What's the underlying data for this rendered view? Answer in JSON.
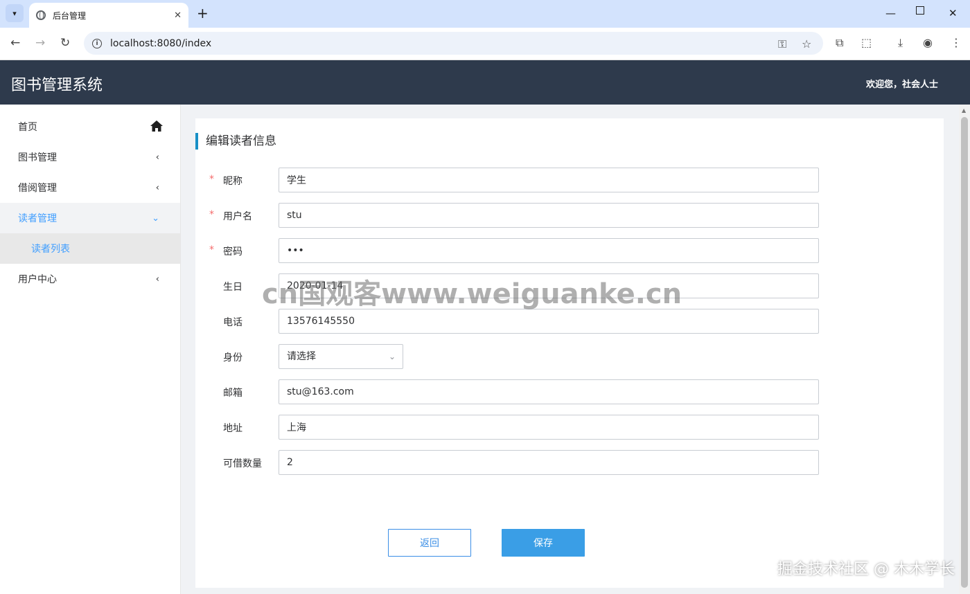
{
  "browser": {
    "tab_title": "后台管理",
    "url": "localhost:8080/index",
    "new_tab": "+",
    "tab_close": "✕"
  },
  "header": {
    "title": "图书管理系统",
    "welcome": "欢迎您，社会人士"
  },
  "sidebar": {
    "items": [
      {
        "label": "首页",
        "icon": "home-icon"
      },
      {
        "label": "图书管理",
        "icon": "chevron-left-icon"
      },
      {
        "label": "借阅管理",
        "icon": "chevron-left-icon"
      },
      {
        "label": "读者管理",
        "icon": "chevron-down-icon",
        "active": true,
        "children": [
          {
            "label": "读者列表"
          }
        ]
      },
      {
        "label": "用户中心",
        "icon": "chevron-left-icon"
      }
    ]
  },
  "form": {
    "title": "编辑读者信息",
    "required_mark": "*",
    "fields": {
      "nickname": {
        "label": "昵称",
        "value": "学生",
        "required": true
      },
      "username": {
        "label": "用户名",
        "value": "stu",
        "required": true
      },
      "password": {
        "label": "密码",
        "value": "•••",
        "required": true
      },
      "birthday": {
        "label": "生日",
        "value": "2020-01-14"
      },
      "phone": {
        "label": "电话",
        "value": "13576145550"
      },
      "identity": {
        "label": "身份",
        "value": "请选择"
      },
      "email": {
        "label": "邮箱",
        "value": "stu@163.com"
      },
      "address": {
        "label": "地址",
        "value": "上海"
      },
      "borrow_limit": {
        "label": "可借数量",
        "value": "2"
      }
    },
    "back_label": "返回",
    "save_label": "保存"
  },
  "watermarks": {
    "center": "cn国观客www.weiguanke.cn",
    "corner": "掘金技术社区 @ 木木学长"
  },
  "colors": {
    "header_bg": "#2e3a4c",
    "accent": "#409eff",
    "save_button": "#3a9ee6",
    "required": "#f56c6c"
  }
}
